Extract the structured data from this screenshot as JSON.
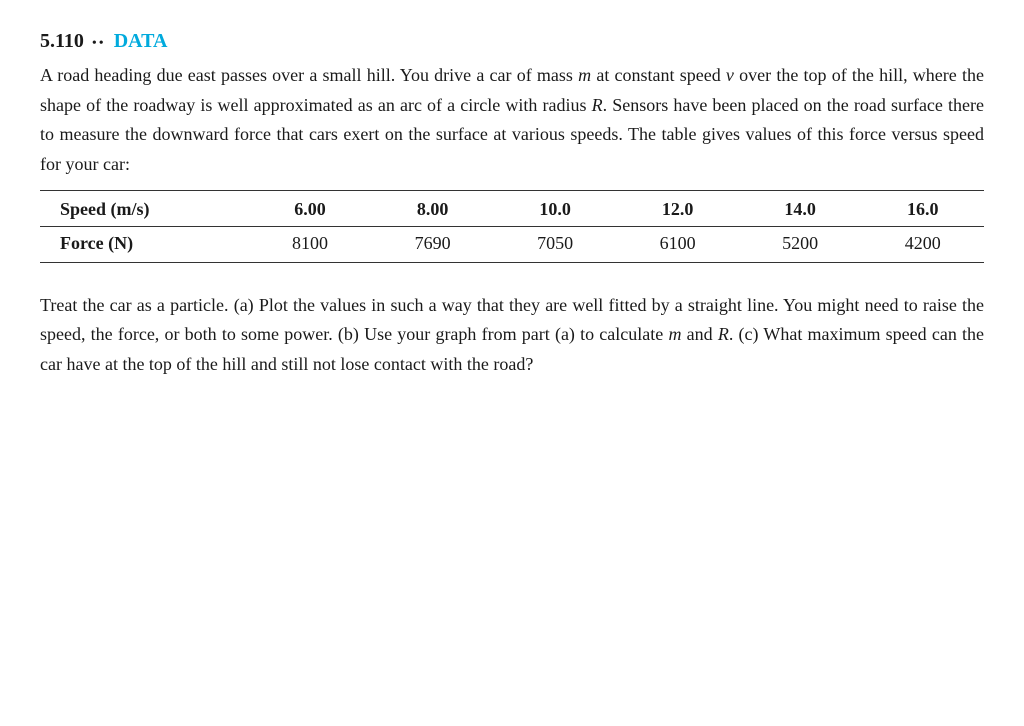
{
  "problem": {
    "number": "5.110",
    "bullets": "••",
    "badge": "DATA",
    "intro_text": "A road heading due east passes over a small hill. You drive a car of mass",
    "mass_var": "m",
    "intro_text2": "at constant speed",
    "speed_var": "v",
    "intro_text3": "over the top of the hill, where the shape of the roadway is well approximated as an arc of a circle with radius",
    "radius_var": "R",
    "intro_text4": ". Sensors have been placed on the road surface there to measure the downward force that cars exert on the surface at various speeds. The table gives values of this force versus speed for your car:",
    "table": {
      "col1_header": "Speed (m/s)",
      "col2_header": "6.00",
      "col3_header": "8.00",
      "col4_header": "10.0",
      "col5_header": "12.0",
      "col6_header": "14.0",
      "col7_header": "16.0",
      "row1_label": "Force (N)",
      "row1_col2": "8100",
      "row1_col3": "7690",
      "row1_col4": "7050",
      "row1_col5": "6100",
      "row1_col6": "5200",
      "row1_col7": "4200"
    },
    "follow_text": "Treat the car as a particle. (a) Plot the values in such a way that they are well fitted by a straight line. You might need to raise the speed, the force, or both to some power. (b) Use your graph from part (a) to calculate",
    "m_var": "m",
    "and_text": "and",
    "r_var": "R",
    "follow_text2": ". (c) What maximum speed can the car have at the top of the hill and still not lose contact with the road?"
  }
}
